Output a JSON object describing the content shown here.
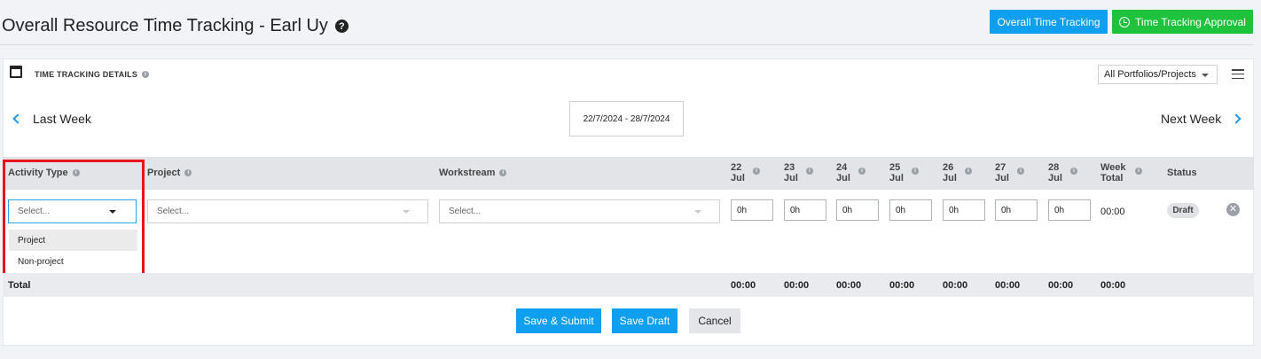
{
  "page": {
    "title": "Overall Resource Time Tracking - Earl Uy",
    "help_icon": "?"
  },
  "header_buttons": {
    "overall": "Overall Time Tracking",
    "approval": "Time Tracking Approval"
  },
  "panel": {
    "title": "TIME TRACKING DETAILS",
    "portfolio_filter": "All Portfolios/Projects"
  },
  "week_nav": {
    "prev": "Last Week",
    "next": "Next Week",
    "range": "22/7/2024 - 28/7/2024"
  },
  "table": {
    "headers": {
      "activity_type": "Activity Type",
      "project": "Project",
      "workstream": "Workstream",
      "week_total": "Week Total",
      "status": "Status"
    },
    "days": [
      {
        "day": "22",
        "month": "Jul"
      },
      {
        "day": "23",
        "month": "Jul"
      },
      {
        "day": "24",
        "month": "Jul"
      },
      {
        "day": "25",
        "month": "Jul"
      },
      {
        "day": "26",
        "month": "Jul"
      },
      {
        "day": "27",
        "month": "Jul"
      },
      {
        "day": "28",
        "month": "Jul"
      }
    ],
    "row": {
      "activity_placeholder": "Select...",
      "project_placeholder": "Select...",
      "workstream_placeholder": "Select...",
      "hours": [
        "0h",
        "0h",
        "0h",
        "0h",
        "0h",
        "0h",
        "0h"
      ],
      "week_total": "00:00",
      "status": "Draft"
    },
    "activity_options": [
      "Project",
      "Non-project"
    ],
    "total": {
      "label": "Total",
      "values": [
        "00:00",
        "00:00",
        "00:00",
        "00:00",
        "00:00",
        "00:00",
        "00:00",
        "00:00"
      ]
    }
  },
  "actions": {
    "submit": "Save & Submit",
    "draft": "Save Draft",
    "cancel": "Cancel"
  },
  "colors": {
    "primary": "#0e9ff0",
    "approval_green": "#1ec23d",
    "highlight_red": "#e8141b"
  }
}
